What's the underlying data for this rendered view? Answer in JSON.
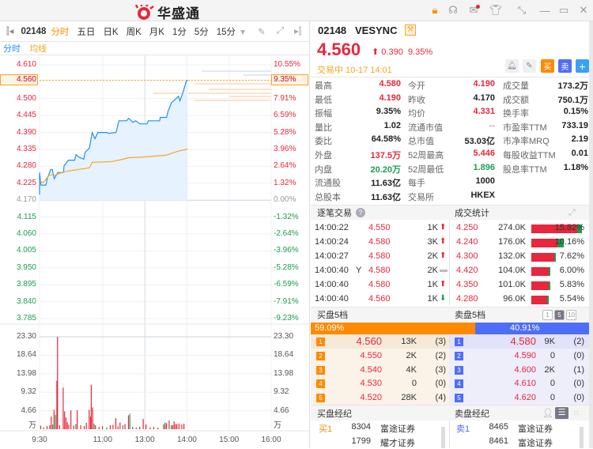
{
  "app": {
    "logo_text": "华盛通"
  },
  "colors": {
    "up": "#e8263c",
    "down": "#1a9e4f",
    "accent": "#ff8a00",
    "sell_blue": "#4f6ef7",
    "line": "#1e90ff",
    "avg": "#f5a623"
  },
  "toolbar": {
    "code": "02148",
    "tabs": [
      "分时",
      "五日",
      "日K",
      "周K",
      "月K",
      "1分",
      "5分",
      "15分"
    ]
  },
  "legend": {
    "line": "分时",
    "avg": "均线"
  },
  "chart_data": {
    "type": "line",
    "title": "02148 分时",
    "prev_close": 4.17,
    "y_ticks": [
      "4.610",
      "4.560",
      "4.500",
      "4.445",
      "4.390",
      "4.335",
      "4.280",
      "4.225",
      "4.170",
      "4.115",
      "4.060",
      "4.005",
      "3.950",
      "3.895",
      "3.840",
      "3.785"
    ],
    "pct_ticks": [
      "10.55%",
      "9.35%",
      "7.91%",
      "6.59%",
      "5.28%",
      "3.96%",
      "2.64%",
      "1.32%",
      "0.00%",
      "-1.32%",
      "-2.64%",
      "-3.96%",
      "-5.28%",
      "-6.59%",
      "-7.91%",
      "-9.23%"
    ],
    "ylim": [
      3.785,
      4.61
    ],
    "current_price_label": "4.560",
    "current_pct_label": "9.35%",
    "x_ticks": [
      "9:30",
      "11:00",
      "13:00",
      "14:00",
      "15:00",
      "16:00"
    ],
    "x_tick_minutes": [
      0,
      90,
      150,
      210,
      270,
      330
    ],
    "price": [
      [
        0,
        4.188
      ],
      [
        0,
        4.26
      ],
      [
        2,
        4.219
      ],
      [
        9,
        4.219
      ],
      [
        11,
        4.24
      ],
      [
        16,
        4.27
      ],
      [
        18,
        4.27
      ],
      [
        21,
        4.24
      ],
      [
        26,
        4.26
      ],
      [
        34,
        4.26
      ],
      [
        35,
        4.282
      ],
      [
        41,
        4.3
      ],
      [
        50,
        4.3
      ],
      [
        52,
        4.318
      ],
      [
        56,
        4.31
      ],
      [
        63,
        4.303
      ],
      [
        65,
        4.326
      ],
      [
        71,
        4.339
      ],
      [
        75,
        4.39
      ],
      [
        79,
        4.37
      ],
      [
        83,
        4.39
      ],
      [
        96,
        4.39
      ],
      [
        98,
        4.387
      ],
      [
        109,
        4.39
      ],
      [
        113,
        4.428
      ],
      [
        124,
        4.428
      ],
      [
        127,
        4.436
      ],
      [
        133,
        4.423
      ],
      [
        137,
        4.428
      ],
      [
        143,
        4.418
      ],
      [
        153,
        4.418
      ],
      [
        155,
        4.428
      ],
      [
        171,
        4.428
      ],
      [
        172,
        4.439
      ],
      [
        181,
        4.439
      ],
      [
        183,
        4.459
      ],
      [
        188,
        4.487
      ],
      [
        196,
        4.503
      ],
      [
        198,
        4.508
      ],
      [
        200,
        4.493
      ],
      [
        204,
        4.518
      ],
      [
        209,
        4.556
      ],
      [
        211,
        4.56
      ]
    ],
    "avg": [
      [
        0,
        4.234
      ],
      [
        5,
        4.226
      ],
      [
        14,
        4.252
      ],
      [
        23,
        4.252
      ],
      [
        34,
        4.262
      ],
      [
        56,
        4.27
      ],
      [
        71,
        4.275
      ],
      [
        75,
        4.293
      ],
      [
        101,
        4.295
      ],
      [
        113,
        4.3
      ],
      [
        127,
        4.308
      ],
      [
        146,
        4.31
      ],
      [
        180,
        4.316
      ],
      [
        197,
        4.329
      ],
      [
        211,
        4.336
      ]
    ],
    "vol_ticks": [
      "23.30",
      "18.64",
      "13.98",
      "9.32",
      "4.66",
      "万"
    ],
    "vol_ylim": [
      0,
      23.3
    ],
    "volume": [
      [
        1,
        0.9,
        "u"
      ],
      [
        5,
        0.5,
        "d"
      ],
      [
        10,
        0.8,
        "u"
      ],
      [
        14,
        1.0,
        "u"
      ],
      [
        16,
        3.2,
        "u"
      ],
      [
        18,
        1.2,
        "d"
      ],
      [
        20,
        4.9,
        "u"
      ],
      [
        22,
        3.6,
        "d"
      ],
      [
        24,
        12.2,
        "u"
      ],
      [
        25,
        23.3,
        "u"
      ],
      [
        28,
        1.0,
        "u"
      ],
      [
        33,
        10.5,
        "u"
      ],
      [
        35,
        4.5,
        "u"
      ],
      [
        37,
        3.0,
        "u"
      ],
      [
        39,
        1.8,
        "u"
      ],
      [
        41,
        1.2,
        "u"
      ],
      [
        44,
        4.8,
        "u"
      ],
      [
        48,
        0.9,
        "u"
      ],
      [
        51,
        1.3,
        "d"
      ],
      [
        53,
        4.8,
        "u"
      ],
      [
        58,
        1.0,
        "u"
      ],
      [
        63,
        0.8,
        "u"
      ],
      [
        66,
        1.6,
        "u"
      ],
      [
        70,
        4.9,
        "u"
      ],
      [
        72,
        3.2,
        "u"
      ],
      [
        73,
        11.2,
        "u"
      ],
      [
        75,
        5.5,
        "u"
      ],
      [
        77,
        1.4,
        "d"
      ],
      [
        79,
        1.0,
        "u"
      ],
      [
        84,
        0.6,
        "u"
      ],
      [
        89,
        0.8,
        "u"
      ],
      [
        95,
        0.5,
        "d"
      ],
      [
        100,
        1.0,
        "u"
      ],
      [
        104,
        1.1,
        "u"
      ],
      [
        108,
        2.8,
        "u"
      ],
      [
        111,
        0.7,
        "u"
      ],
      [
        114,
        1.7,
        "u"
      ],
      [
        118,
        1.0,
        "d"
      ],
      [
        121,
        1.3,
        "u"
      ],
      [
        126,
        3.5,
        "u"
      ],
      [
        128,
        3.9,
        "d"
      ],
      [
        132,
        0.6,
        "u"
      ],
      [
        137,
        0.5,
        "d"
      ],
      [
        142,
        0.6,
        "u"
      ],
      [
        147,
        2.6,
        "u"
      ],
      [
        151,
        1.2,
        "u"
      ],
      [
        157,
        0.5,
        "u"
      ],
      [
        162,
        0.6,
        "u"
      ],
      [
        168,
        0.4,
        "u"
      ],
      [
        176,
        1.2,
        "u"
      ],
      [
        178,
        1.7,
        "d"
      ],
      [
        180,
        1.5,
        "u"
      ],
      [
        184,
        2.2,
        "u"
      ],
      [
        187,
        1.0,
        "d"
      ],
      [
        189,
        1.0,
        "u"
      ],
      [
        191,
        2.0,
        "u"
      ],
      [
        193,
        1.3,
        "u"
      ],
      [
        195,
        1.3,
        "u"
      ],
      [
        198,
        1.4,
        "u"
      ],
      [
        202,
        1.2,
        "u"
      ],
      [
        205,
        1.4,
        "u"
      ]
    ]
  },
  "quote": {
    "code": "02148",
    "name": "VESYNC",
    "price": "4.560",
    "change": "0.390",
    "change_pct": "9.35%",
    "status": "交易中 10-17 14:01",
    "buy_btn": "买",
    "sell_btn": "卖",
    "plus_btn": "+"
  },
  "stats": [
    [
      [
        "最高",
        "4.580",
        "red"
      ],
      [
        "今开",
        "4.190",
        "red"
      ],
      [
        "成交量",
        "173.2万",
        ""
      ]
    ],
    [
      [
        "最低",
        "4.190",
        "red"
      ],
      [
        "昨收",
        "4.170",
        ""
      ],
      [
        "成交额",
        "750.1万",
        ""
      ]
    ],
    [
      [
        "振幅",
        "9.35%",
        ""
      ],
      [
        "均价",
        "4.331",
        "red"
      ],
      [
        "换手率",
        "0.15%",
        ""
      ]
    ],
    [
      [
        "量比",
        "1.02",
        ""
      ],
      [
        "流通市值",
        "--",
        "gray"
      ],
      [
        "市盈率TTM",
        "733.19",
        ""
      ]
    ],
    [
      [
        "委比",
        "64.58%",
        ""
      ],
      [
        "总市值",
        "53.03亿",
        ""
      ],
      [
        "市净率MRQ",
        "2.19",
        ""
      ]
    ],
    [
      [
        "外盘",
        "137.5万",
        "red"
      ],
      [
        "52周最高",
        "5.446",
        "red"
      ],
      [
        "每股收益TTM",
        "0.01",
        ""
      ]
    ],
    [
      [
        "内盘",
        "20.20万",
        "green"
      ],
      [
        "52周最低",
        "1.896",
        "green"
      ],
      [
        "股息率TTM",
        "1.18%",
        ""
      ]
    ],
    [
      [
        "流通股",
        "11.63亿",
        ""
      ],
      [
        "每手",
        "1000",
        ""
      ],
      [
        "",
        "",
        " "
      ]
    ],
    [
      [
        "总股本",
        "11.63亿",
        ""
      ],
      [
        "交易所",
        "HKEX",
        ""
      ],
      [
        "",
        "",
        " "
      ]
    ]
  ],
  "ticks": {
    "title": "逐笔交易",
    "rows": [
      {
        "time": "14:00:22",
        "flag": "",
        "price": "4.550",
        "qty": "1K",
        "dir": "up"
      },
      {
        "time": "14:00:24",
        "flag": "",
        "price": "4.580",
        "qty": "3K",
        "dir": "up"
      },
      {
        "time": "14:00:27",
        "flag": "",
        "price": "4.580",
        "qty": "2K",
        "dir": "up"
      },
      {
        "time": "14:00:40",
        "flag": "Y",
        "price": "4.580",
        "qty": "2K",
        "dir": "flat"
      },
      {
        "time": "14:00:40",
        "flag": "",
        "price": "4.580",
        "qty": "1K",
        "dir": "up"
      },
      {
        "time": "14:00:40",
        "flag": "",
        "price": "4.560",
        "qty": "1K",
        "dir": "down"
      }
    ]
  },
  "volstats": {
    "title": "成交统计",
    "rows": [
      {
        "price": "4.250",
        "vol": "274.0K",
        "pct": "15.82%",
        "ratio": 15.82,
        "green": 0.1
      },
      {
        "price": "4.240",
        "vol": "176.0K",
        "pct": "10.16%",
        "ratio": 10.16,
        "green": 0.2
      },
      {
        "price": "4.300",
        "vol": "132.0K",
        "pct": "7.62%",
        "ratio": 7.62,
        "green": 0.04
      },
      {
        "price": "4.420",
        "vol": "104.0K",
        "pct": "6.00%",
        "ratio": 6.0,
        "green": 0.05
      },
      {
        "price": "4.350",
        "vol": "101.0K",
        "pct": "5.83%",
        "ratio": 5.83,
        "green": 0.03
      },
      {
        "price": "4.280",
        "vol": "96.0K",
        "pct": "5.54%",
        "ratio": 5.54,
        "green": 0.04
      }
    ]
  },
  "orderbook": {
    "bid_title": "买盘5档",
    "ask_title": "卖盘5档",
    "depth_opts": [
      "1",
      "5",
      "10"
    ],
    "bid_pct": "59.09%",
    "ask_pct": "40.91%",
    "bid_ratio": 59.09,
    "bids": [
      [
        "1",
        "4.560",
        "13K",
        "(3)"
      ],
      [
        "2",
        "4.550",
        "2K",
        "(2)"
      ],
      [
        "3",
        "4.540",
        "4K",
        "(3)"
      ],
      [
        "4",
        "4.530",
        "0",
        "(0)"
      ],
      [
        "5",
        "4.520",
        "28K",
        "(4)"
      ]
    ],
    "asks": [
      [
        "1",
        "4.580",
        "9K",
        "(2)"
      ],
      [
        "2",
        "4.590",
        "0",
        "(0)"
      ],
      [
        "3",
        "4.600",
        "2K",
        "(1)"
      ],
      [
        "4",
        "4.610",
        "0",
        "(0)"
      ],
      [
        "5",
        "4.620",
        "0",
        "(0)"
      ]
    ]
  },
  "brokers": {
    "bid_title": "买盘经纪",
    "ask_title": "卖盘经纪",
    "bids": [
      [
        "买1",
        "8304",
        "富途证券"
      ],
      [
        "",
        "1799",
        "耀才证券"
      ]
    ],
    "asks": [
      [
        "卖1",
        "8465",
        "富途证券"
      ],
      [
        "",
        "8461",
        "富途证券"
      ]
    ]
  }
}
